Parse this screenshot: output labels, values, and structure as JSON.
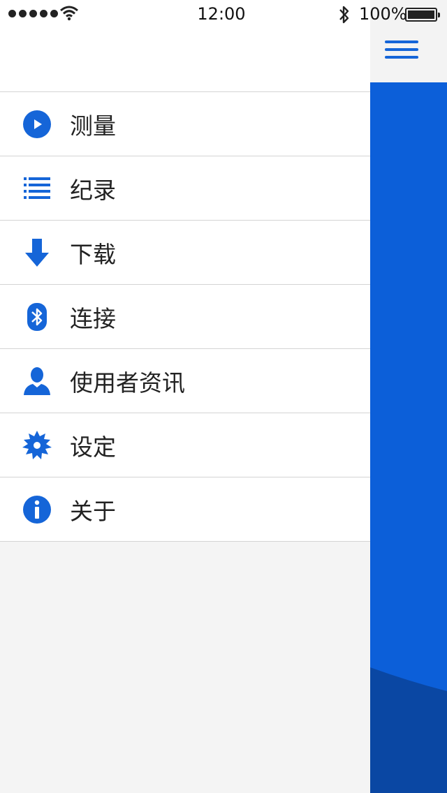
{
  "status_bar": {
    "time": "12:00",
    "battery_percent": "100%",
    "signal_bars": 5,
    "icons": [
      "signal-dots-icon",
      "wifi-icon",
      "bluetooth-icon",
      "battery-icon"
    ]
  },
  "menu": {
    "items": [
      {
        "label": "测量",
        "icon": "play-circle-icon"
      },
      {
        "label": "纪录",
        "icon": "list-icon"
      },
      {
        "label": "下载",
        "icon": "download-arrow-icon"
      },
      {
        "label": "连接",
        "icon": "bluetooth-icon"
      },
      {
        "label": "使用者资讯",
        "icon": "user-icon"
      },
      {
        "label": "设定",
        "icon": "gear-icon"
      },
      {
        "label": "关于",
        "icon": "info-icon"
      }
    ]
  },
  "main_panel": {
    "menu_button_icon": "hamburger-menu-icon"
  },
  "colors": {
    "accent": "#1565d8",
    "panel_blue": "#0c5fd9",
    "panel_dark_blue": "#0a47a3",
    "drawer_background": "#f4f4f4",
    "row_background": "#ffffff",
    "divider": "#d4d4d4"
  }
}
